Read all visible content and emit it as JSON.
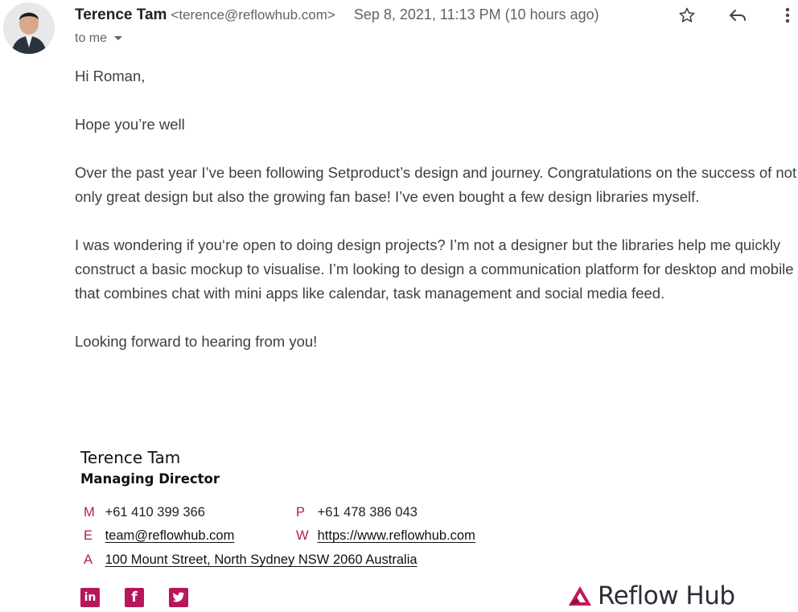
{
  "email": {
    "sender_name": "Terence Tam",
    "sender_email": "<terence@reflowhub.com>",
    "date": "Sep 8, 2021, 11:13 PM (10 hours ago)",
    "recipient": "to me",
    "body": [
      "Hi Roman,",
      "Hope you’re well",
      "Over the past year I’ve been following Setproduct’s design and journey. Congratulations on the success of not only great design but also the growing fan base! I’ve even bought a few design libraries myself.",
      "I was wondering if you‘re open to doing design projects? I’m not a designer but the libraries help me quickly construct a basic mockup to visualise. I’m looking to design a communication platform for desktop and mobile that combines chat with mini apps like calendar, task management and social media feed.",
      "Looking forward to hearing from you!"
    ]
  },
  "signature": {
    "name": "Terence Tam",
    "title": "Managing Director",
    "mobile_letter": "M",
    "mobile": "+61 410 399 366",
    "phone_letter": "P",
    "phone": "+61 478 386 043",
    "email_letter": "E",
    "email": "team@reflowhub.com",
    "web_letter": "W",
    "web": "https://www.reflowhub.com",
    "address_letter": "A",
    "address": "100 Mount Street, North Sydney NSW 2060 Australia",
    "logo_text": "Reflow Hub",
    "social": {
      "linkedin": "in",
      "facebook": "f"
    }
  },
  "colors": {
    "accent": "#b8165a",
    "text": "#3c4043",
    "muted": "#5f6368"
  },
  "icons": [
    "star-icon",
    "reply-icon",
    "more-vert-icon",
    "dropdown-arrow-icon",
    "linkedin-icon",
    "facebook-icon",
    "twitter-icon",
    "reflow-hub-logo-icon"
  ]
}
